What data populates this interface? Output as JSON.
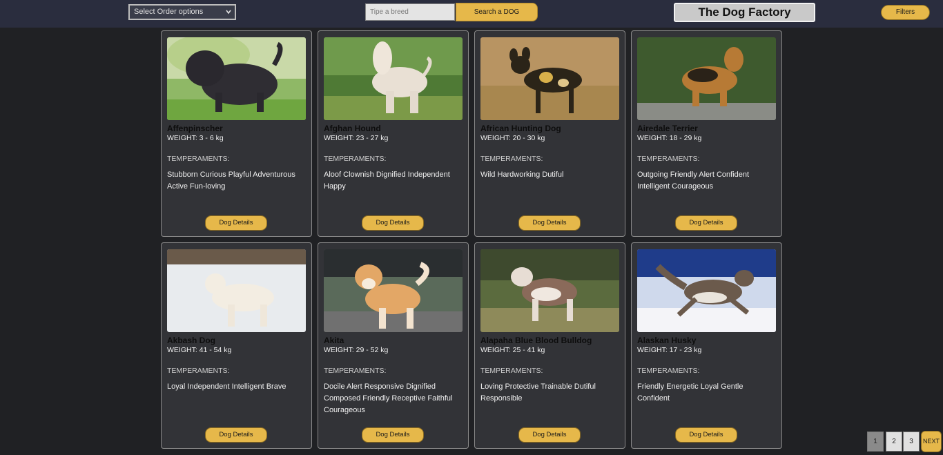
{
  "header": {
    "order_select": "Select Order options",
    "search_placeholder": "Tipe a breed",
    "search_button": "Search a DOG",
    "brand": "The Dog Factory",
    "filters_button": "Filters"
  },
  "cards": [
    {
      "name": "Affenpinscher",
      "weight": "WEIGHT: 3 - 6 kg",
      "temp_label": "TEMPERAMENTS:",
      "temperaments": "Stubborn Curious Playful Adventurous Active Fun-loving",
      "button": "Dog Details"
    },
    {
      "name": "Afghan Hound",
      "weight": "WEIGHT: 23 - 27 kg",
      "temp_label": "TEMPERAMENTS:",
      "temperaments": "Aloof Clownish Dignified Independent Happy",
      "button": "Dog Details"
    },
    {
      "name": "African Hunting Dog",
      "weight": "WEIGHT: 20 - 30 kg",
      "temp_label": "TEMPERAMENTS:",
      "temperaments": "Wild Hardworking Dutiful",
      "button": "Dog Details"
    },
    {
      "name": "Airedale Terrier",
      "weight": "WEIGHT: 18 - 29 kg",
      "temp_label": "TEMPERAMENTS:",
      "temperaments": "Outgoing Friendly Alert Confident Intelligent Courageous",
      "button": "Dog Details"
    },
    {
      "name": "Akbash Dog",
      "weight": "WEIGHT: 41 - 54 kg",
      "temp_label": "TEMPERAMENTS:",
      "temperaments": "Loyal Independent Intelligent Brave",
      "button": "Dog Details"
    },
    {
      "name": "Akita",
      "weight": "WEIGHT: 29 - 52 kg",
      "temp_label": "TEMPERAMENTS:",
      "temperaments": "Docile Alert Responsive Dignified Composed Friendly Receptive Faithful Courageous",
      "button": "Dog Details"
    },
    {
      "name": "Alapaha Blue Blood Bulldog",
      "weight": "WEIGHT: 25 - 41 kg",
      "temp_label": "TEMPERAMENTS:",
      "temperaments": "Loving Protective Trainable Dutiful Responsible",
      "button": "Dog Details"
    },
    {
      "name": "Alaskan Husky",
      "weight": "WEIGHT: 17 - 23 kg",
      "temp_label": "TEMPERAMENTS:",
      "temperaments": "Friendly Energetic Loyal Gentle Confident",
      "button": "Dog Details"
    }
  ],
  "pagination": {
    "pages": [
      "1",
      "2",
      "3"
    ],
    "active": "1",
    "next": "NEXT"
  },
  "colors": {
    "accent": "#e6b84a",
    "background": "#202124",
    "header": "#2a2d3e",
    "card": "#323337"
  }
}
